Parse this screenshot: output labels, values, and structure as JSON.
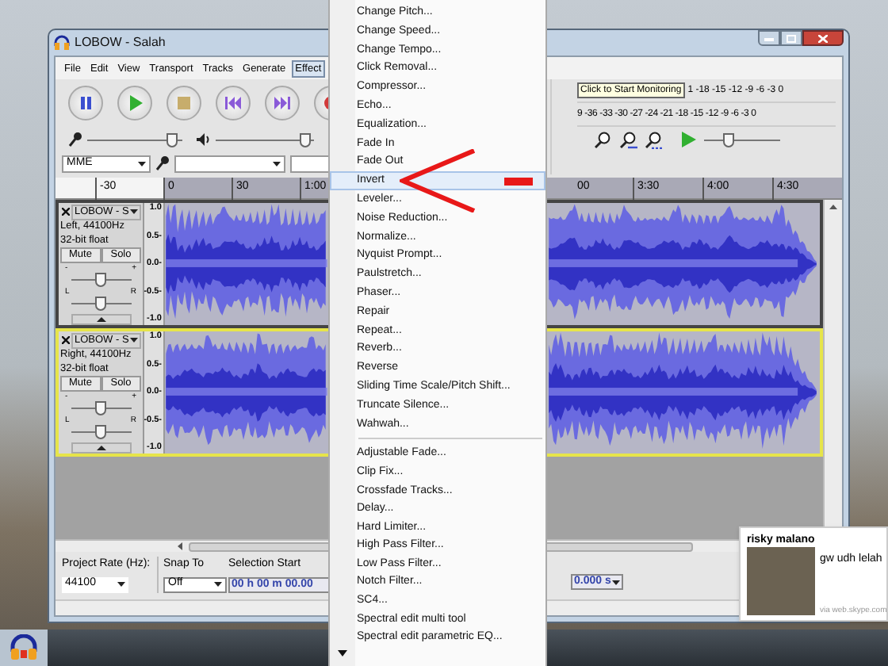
{
  "window": {
    "title": "LOBOW - Salah"
  },
  "menu_bar": [
    {
      "label": "File",
      "selected": false
    },
    {
      "label": "Edit",
      "selected": false
    },
    {
      "label": "View",
      "selected": false
    },
    {
      "label": "Transport",
      "selected": false
    },
    {
      "label": "Tracks",
      "selected": false
    },
    {
      "label": "Generate",
      "selected": false
    },
    {
      "label": "Effect",
      "selected": true
    }
  ],
  "transport": [
    {
      "kind": "pause"
    },
    {
      "kind": "play"
    },
    {
      "kind": "stop"
    },
    {
      "kind": "skip-start"
    },
    {
      "kind": "skip-end"
    },
    {
      "kind": "record"
    }
  ],
  "mixer": {
    "input": {
      "level": 0.95
    },
    "output": {
      "level": 0.97
    }
  },
  "device_bar": {
    "host": "MME"
  },
  "meters": {
    "tooltip": "Click to Start Monitoring",
    "record_scale": "1 -18 -15 -12 -9 -6 -3 0",
    "playback_scale": "9 -36 -33 -30 -27 -24 -21 -18 -15 -12 -9 -6 -3 0"
  },
  "play_at_speed": {
    "level": 0.3
  },
  "ruler": {
    "left_labels": [
      "-30",
      "0",
      "30",
      "1:00"
    ],
    "right_labels": [
      "00",
      "3:30",
      "4:00",
      "4:30"
    ]
  },
  "tracks": [
    {
      "name": "LOBOW - S",
      "channel": "Left, 44100Hz",
      "format": "32-bit float",
      "mute": "Mute",
      "solo": "Solo",
      "gain_labels": [
        "-",
        "+"
      ],
      "gain": {
        "level": 0.5
      },
      "pan_labels": [
        "L",
        "R"
      ],
      "pan": {
        "level": 0.5
      },
      "scale": [
        "1.0",
        "0.5-",
        "0.0-",
        "-0.5-",
        "-1.0"
      ],
      "selected": false
    },
    {
      "name": "LOBOW - S",
      "channel": "Right, 44100Hz",
      "format": "32-bit float",
      "mute": "Mute",
      "solo": "Solo",
      "gain_labels": [
        "-",
        "+"
      ],
      "gain": {
        "level": 0.5
      },
      "pan_labels": [
        "L",
        "R"
      ],
      "pan": {
        "level": 0.5
      },
      "scale": [
        "1.0",
        "0.5-",
        "0.0-",
        "-0.5-",
        "-1.0"
      ],
      "selected": true
    }
  ],
  "effect_menu": {
    "groups": [
      {
        "items": [
          {
            "label": "Change Pitch...",
            "selected": false
          },
          {
            "label": "Change Speed...",
            "selected": false
          },
          {
            "label": "Change Tempo...",
            "selected": false
          },
          {
            "label": "Click Removal...",
            "selected": false
          },
          {
            "label": "Compressor...",
            "selected": false
          },
          {
            "label": "Echo...",
            "selected": false
          },
          {
            "label": "Equalization...",
            "selected": false
          },
          {
            "label": "Fade In",
            "selected": false
          },
          {
            "label": "Fade Out",
            "selected": false
          },
          {
            "label": "Invert",
            "selected": true
          },
          {
            "label": "Leveler...",
            "selected": false
          },
          {
            "label": "Noise Reduction...",
            "selected": false
          },
          {
            "label": "Normalize...",
            "selected": false
          },
          {
            "label": "Nyquist Prompt...",
            "selected": false
          },
          {
            "label": "Paulstretch...",
            "selected": false
          },
          {
            "label": "Phaser...",
            "selected": false
          },
          {
            "label": "Repair",
            "selected": false
          },
          {
            "label": "Repeat...",
            "selected": false
          },
          {
            "label": "Reverb...",
            "selected": false
          },
          {
            "label": "Reverse",
            "selected": false
          },
          {
            "label": "Sliding Time Scale/Pitch Shift...",
            "selected": false
          },
          {
            "label": "Truncate Silence...",
            "selected": false
          },
          {
            "label": "Wahwah...",
            "selected": false
          }
        ]
      },
      {
        "items": [
          {
            "label": "Adjustable Fade...",
            "selected": false
          },
          {
            "label": "Clip Fix...",
            "selected": false
          },
          {
            "label": "Crossfade Tracks...",
            "selected": false
          },
          {
            "label": "Delay...",
            "selected": false
          },
          {
            "label": "Hard Limiter...",
            "selected": false
          },
          {
            "label": "High Pass Filter...",
            "selected": false
          },
          {
            "label": "Low Pass Filter...",
            "selected": false
          },
          {
            "label": "Notch Filter...",
            "selected": false
          },
          {
            "label": "SC4...",
            "selected": false
          },
          {
            "label": "Spectral edit multi tool",
            "selected": false
          },
          {
            "label": "Spectral edit parametric EQ...",
            "selected": false
          }
        ]
      }
    ]
  },
  "bottom_bar": {
    "project_rate_label": "Project Rate (Hz):",
    "project_rate": "44100",
    "snap_label": "Snap To",
    "snap": "Off",
    "selection_start_label": "Selection Start",
    "selection_start": "00 h 00 m 00.00",
    "selection_end_tail": "0.000 s"
  },
  "notification": {
    "sender": "risky malano",
    "message": "gw udh lelah",
    "source": "via web.skype.com"
  }
}
